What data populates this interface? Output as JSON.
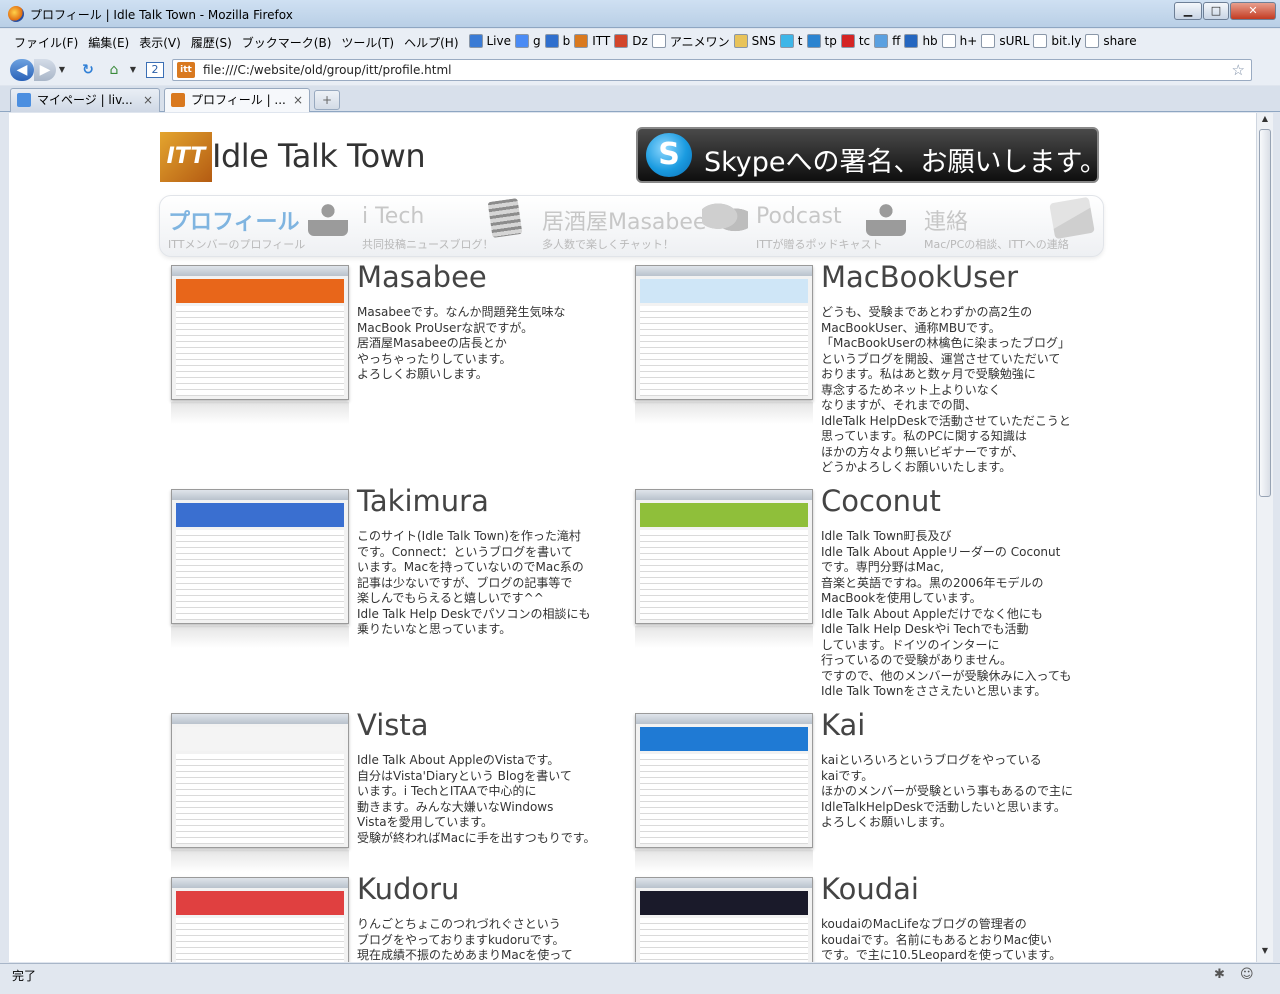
{
  "window": {
    "title": "プロフィール | Idle Talk Town - Mozilla Firefox",
    "min_glyph": "▁",
    "max_glyph": "□",
    "close_glyph": "✕"
  },
  "menus": [
    "ファイル(F)",
    "編集(E)",
    "表示(V)",
    "履歴(S)",
    "ブックマーク(B)",
    "ツール(T)",
    "ヘルプ(H)"
  ],
  "bookmarks": [
    {
      "label": "Live",
      "icon": "windows-live-icon",
      "color": "#3a7bd5"
    },
    {
      "label": "g",
      "icon": "google-icon",
      "color": "#4a8bf5"
    },
    {
      "label": "b",
      "icon": "bing-icon",
      "color": "#2f6fce"
    },
    {
      "label": "ITT",
      "icon": "itt-icon",
      "color": "#d9791f"
    },
    {
      "label": "Dz",
      "icon": "dazz-icon",
      "color": "#d2452b"
    },
    {
      "label": "アニメワン",
      "icon": "page-icon",
      "color": "#ffffff"
    },
    {
      "label": "SNS",
      "icon": "folder-icon",
      "color": "#e8c35a"
    },
    {
      "label": "t",
      "icon": "twitter-icon",
      "color": "#3db6e8"
    },
    {
      "label": "tp",
      "icon": "tp-icon",
      "color": "#2a83d0"
    },
    {
      "label": "tc",
      "icon": "tc-icon",
      "color": "#d42424"
    },
    {
      "label": "ff",
      "icon": "ff-icon",
      "color": "#5aa0e0"
    },
    {
      "label": "hb",
      "icon": "hatena-icon",
      "color": "#2466c0"
    },
    {
      "label": "h+",
      "icon": "page-icon",
      "color": "#ffffff"
    },
    {
      "label": "sURL",
      "icon": "page-icon",
      "color": "#ffffff"
    },
    {
      "label": "bit.ly",
      "icon": "page-icon",
      "color": "#ffffff"
    },
    {
      "label": "share",
      "icon": "page-icon",
      "color": "#ffffff"
    }
  ],
  "nav": {
    "back": "◀",
    "forward": "▶",
    "history": "▼",
    "reload": "↻",
    "home": "⌂",
    "dropdown": "▼",
    "two": "2",
    "site_icon": "itt",
    "url": "file:///C:/website/old/group/itt/profile.html",
    "bookmark_star": "☆"
  },
  "tabs": [
    {
      "title": "マイページ | liv...",
      "close": "×",
      "icon_color": "#4c8fe0"
    },
    {
      "title": "プロフィール | ...",
      "close": "×",
      "icon_color": "#d9791f"
    }
  ],
  "newtab": "+",
  "site": {
    "logo_mark": "ITT",
    "title": "Idle Talk Town",
    "skype_logo": "S",
    "skype_banner": "Skypeへの署名、お願いします。"
  },
  "navmenu": [
    {
      "label": "プロフィール",
      "sub": "ITTメンバーのプロフィール"
    },
    {
      "label": "i Tech",
      "sub": "共同投稿ニュースブログ！"
    },
    {
      "label": "居酒屋Masabee",
      "sub": "多人数で楽しくチャット！"
    },
    {
      "label": "Podcast",
      "sub": "ITTが贈るポッドキャスト"
    },
    {
      "label": "連絡",
      "sub": "Mac/PCの相談、ITTへの連絡"
    }
  ],
  "members": [
    {
      "name": "Masabee",
      "desc": "Masabeeです。なんか問題発生気味な\nMacBook ProUserな訳ですが。\n居酒屋Masabeeの店長とか\nやっちゃったりしています。\nよろしくお願いします。",
      "head": "#e8661a"
    },
    {
      "name": "MacBookUser",
      "desc": "どうも、受験まであとわずかの高2生の\nMacBookUser、通称MBUです。\n「MacBookUserの林檎色に染まったブログ」\nというブログを開設、運営させていただいて\nおります。私はあと数ヶ月で受験勉強に\n専念するためネット上よりいなく\nなりますが、それまでの間、\nIdleTalk HelpDeskで活動させていただこうと\n思っています。私のPCに関する知識は\nほかの方々より無いビギナーですが、\nどうかよろしくお願いいたします。",
      "head": "#cfe6f7"
    },
    {
      "name": "Takimura",
      "desc": "このサイト(Idle Talk Town)を作った滝村\nです。Connect：というブログを書いて\nいます。Macを持っていないのでMac系の\n記事は少ないですが、ブログの記事等で\n楽しんでもらえると嬉しいです^^\nIdle Talk Help Deskでパソコンの相談にも\n乗りたいなと思っています。",
      "head": "#3a6fd0"
    },
    {
      "name": "Coconut",
      "desc": "Idle Talk Town町長及び\nIdle Talk About Appleリーダーの Coconut\nです。専門分野はMac,\n音楽と英語ですね。黒の2006年モデルの\nMacBookを使用しています。\nIdle Talk About Appleだけでなく他にも\nIdle Talk Help Deskやi Techでも活動\nしています。ドイツのインターに\n行っているので受験がありません。\nですので、他のメンバーが受験休みに入っても\nIdle Talk Townをささえたいと思います。",
      "head": "#8fbf3a"
    },
    {
      "name": "Vista",
      "desc": "Idle Talk About AppleのVistaです。\n自分はVista'Diaryという Blogを書いて\nいます。i TechとITAAで中心的に\n動きます。みんな大嫌いなWindows\nVistaを愛用しています。\n受験が終わればMacに手を出すつもりです。",
      "head": "#f4f4f4"
    },
    {
      "name": "Kai",
      "desc": "kaiといろいろというブログをやっている\nkaiです。\nほかのメンバーが受験という事もあるので主に\nIdleTalkHelpDeskで活動したいと思います。\nよろしくお願いします。",
      "head": "#1f7ad4"
    },
    {
      "name": "Kudoru",
      "desc": "りんごとちょこのつれづれぐさという\nブログをやっておりますkudoruです。\n現在成績不振のためあまりMacを使って",
      "head": "#e04040"
    },
    {
      "name": "Koudai",
      "desc": "koudaiのMacLifeなブログの管理者の\nkoudaiです。名前にもあるとおりMac使い\nです。で主に10.5Leopardを使っています。",
      "head": "#1a1a2a"
    }
  ],
  "status": {
    "text": "完了",
    "icon1": "✱",
    "icon2": "☺"
  },
  "colors": {
    "accent_blue": "#7fb4e0",
    "nav_gray": "#c7c7c7",
    "itt_orange": "#d9791f"
  }
}
